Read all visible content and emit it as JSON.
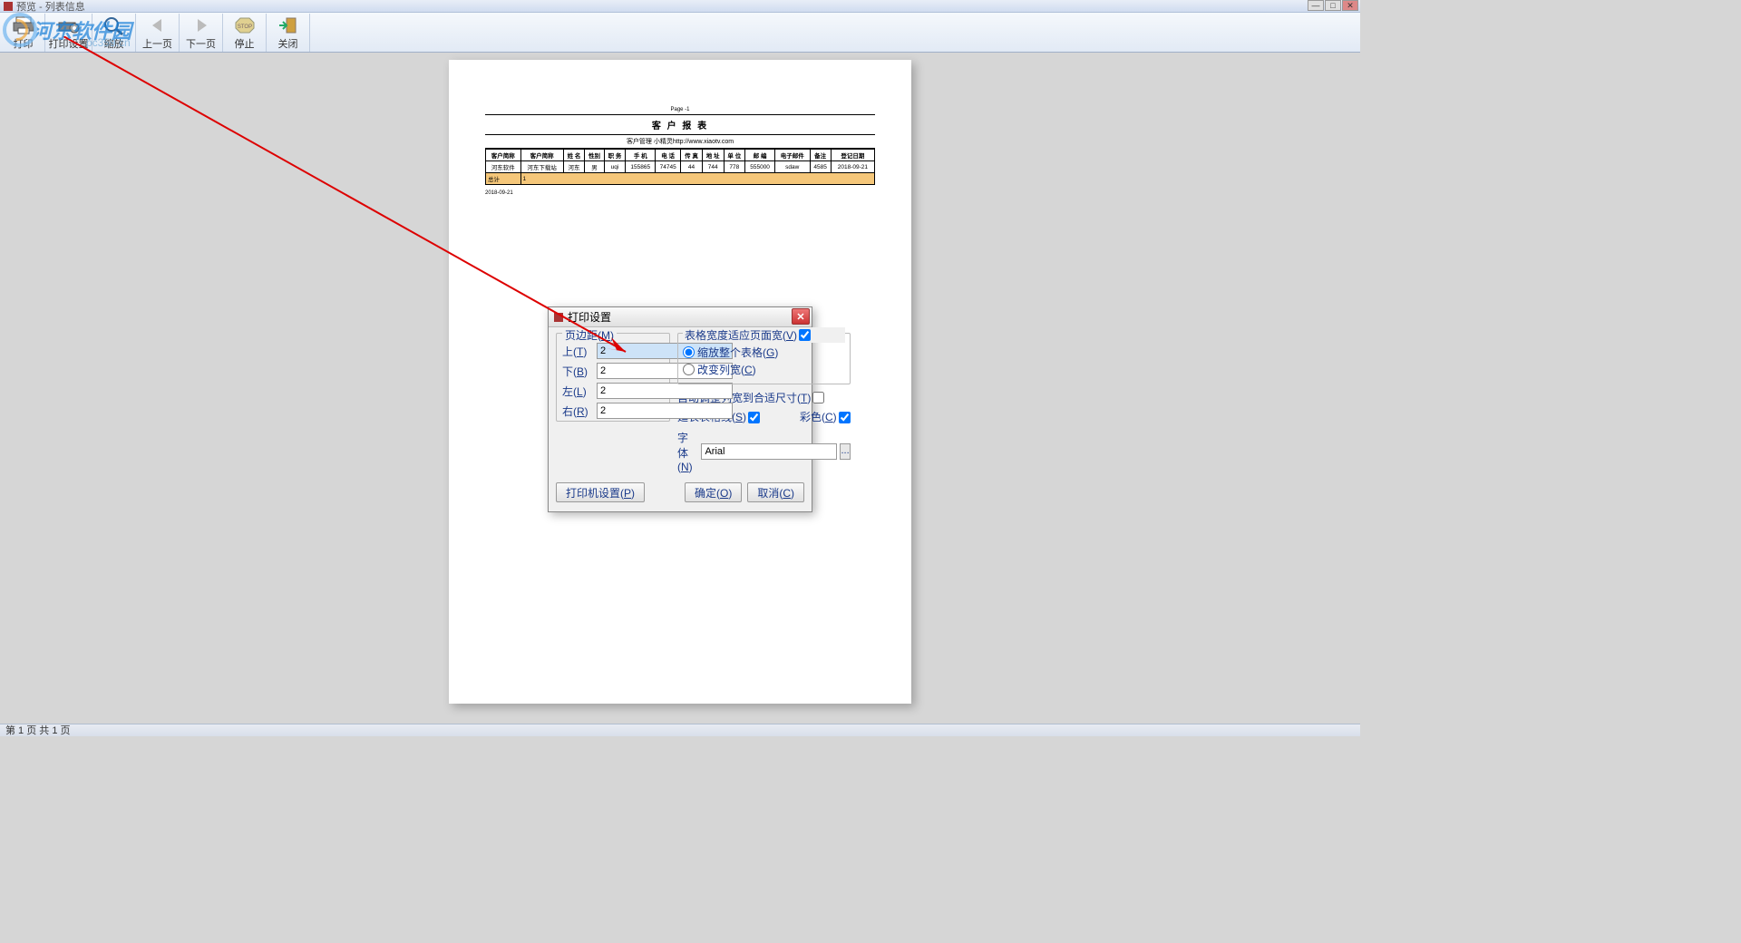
{
  "window": {
    "title": "预览 - 列表信息"
  },
  "toolbar": {
    "print": "打印",
    "print_setup": "打印设置",
    "zoom": "缩放",
    "prev": "上一页",
    "next": "下一页",
    "stop": "停止",
    "close": "关闭"
  },
  "page": {
    "number": "Page -1",
    "title": "客 户 报 表",
    "subtitle": "客户管理 小精灵http://www.xiaotv.com",
    "headers": [
      "客户简称",
      "客户简称",
      "姓 名",
      "性别",
      "职 务",
      "手 机",
      "电 话",
      "传 真",
      "地 址",
      "单 位",
      "邮 编",
      "电子邮件",
      "备注",
      "登记日期"
    ],
    "rows": [
      [
        "河东软件",
        "河东下载站",
        "河东",
        "男",
        "uqi",
        "155865",
        "74745",
        "44",
        "744",
        "778",
        "555000",
        "sdaw",
        "4585",
        "2018-09-21"
      ]
    ],
    "summary_label": "总计",
    "summary_count": "1",
    "date": "2018-09-21"
  },
  "dialog": {
    "title": "打印设置",
    "margins": {
      "legend": "页边距(M)",
      "top_label": "上(T)",
      "top": "2",
      "bottom_label": "下(B)",
      "bottom": "2",
      "left_label": "左(L)",
      "left": "2",
      "right_label": "右(R)",
      "right": "2"
    },
    "table_width": {
      "fit_page": "表格宽度适应页面宽(V)",
      "scale_all": "缩放整个表格(G)",
      "change_col": "改变列宽(C)"
    },
    "auto_adjust": "自动调整列宽到合适尺寸(T)",
    "extend_lines": "延长表格线(S)",
    "color": "彩色(C)",
    "font_label": "字体(N)",
    "font_value": "Arial",
    "font_browse": "...",
    "printer_setup": "打印机设置(P)",
    "ok": "确定(O)",
    "cancel": "取消(C)"
  },
  "statusbar": "第 1 页 共 1 页",
  "watermark": {
    "text": "河东软件园",
    "url": "pc359.cn"
  }
}
